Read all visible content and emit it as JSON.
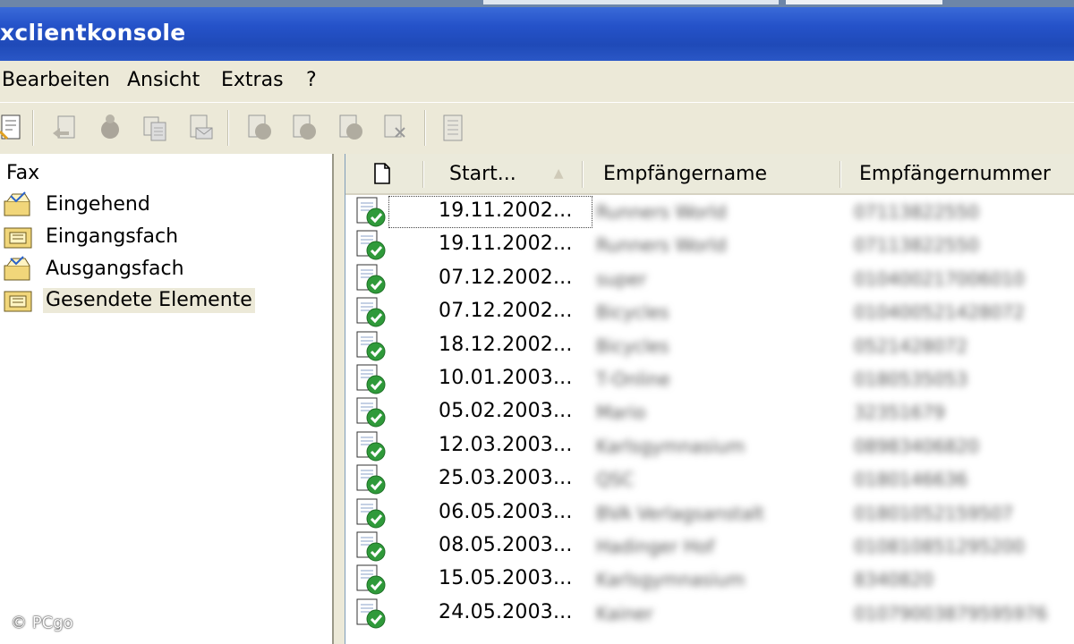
{
  "window": {
    "title": "xclientkonsole"
  },
  "menu": {
    "items": [
      "Bearbeiten",
      "Ansicht",
      "Extras",
      "?"
    ]
  },
  "toolbar": {
    "icons": [
      "new-fax-icon",
      "reply-icon",
      "forward-icon",
      "print-icon",
      "mail-icon",
      "doc-arrow-icon",
      "doc-arrow-2-icon",
      "doc-arrow-3-icon",
      "delete-doc-icon",
      "properties-icon"
    ]
  },
  "tree": {
    "root": "Fax",
    "items": [
      {
        "label": "Eingehend",
        "icon": "incoming-fax-icon",
        "selected": false
      },
      {
        "label": "Eingangsfach",
        "icon": "inbox-folder-icon",
        "selected": false
      },
      {
        "label": "Ausgangsfach",
        "icon": "outbox-fax-icon",
        "selected": false
      },
      {
        "label": "Gesendete Elemente",
        "icon": "sent-folder-icon",
        "selected": true
      }
    ]
  },
  "list": {
    "columns": [
      "Start...",
      "Empfängername",
      "Empfängernummer"
    ],
    "sort_indicator": "▲",
    "rows": [
      {
        "date": "19.11.2002...",
        "name": "Runners World",
        "number": "07113822550"
      },
      {
        "date": "19.11.2002...",
        "name": "Runners World",
        "number": "07113822550"
      },
      {
        "date": "07.12.2002...",
        "name": "super",
        "number": "010400217006010"
      },
      {
        "date": "07.12.2002...",
        "name": "Bicycles",
        "number": "010400521428072"
      },
      {
        "date": "18.12.2002...",
        "name": "Bicycles",
        "number": "0521428072"
      },
      {
        "date": "10.01.2003...",
        "name": "T-Online",
        "number": "0180535053"
      },
      {
        "date": "05.02.2003...",
        "name": "Mario",
        "number": "32351679"
      },
      {
        "date": "12.03.2003...",
        "name": "Karlsgymnasium",
        "number": "08983406820"
      },
      {
        "date": "25.03.2003...",
        "name": "QSC",
        "number": "0180146636"
      },
      {
        "date": "06.05.2003...",
        "name": "BVA Verlagsanstalt",
        "number": "01801052159507"
      },
      {
        "date": "08.05.2003...",
        "name": "Hadinger Hof",
        "number": "010810851295200"
      },
      {
        "date": "15.05.2003...",
        "name": "Karlsgymnasium",
        "number": "8340820"
      },
      {
        "date": "24.05.2003...",
        "name": "Kainer",
        "number": "01079003879595976"
      }
    ]
  },
  "watermark": "© PCgo"
}
